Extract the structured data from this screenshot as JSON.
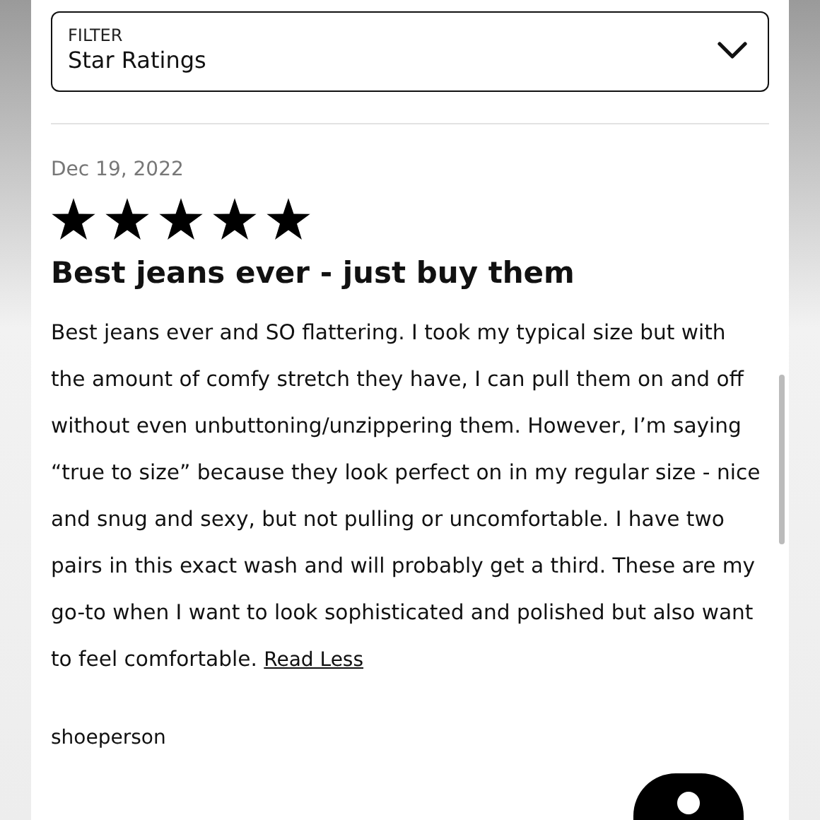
{
  "filter": {
    "label": "FILTER",
    "value": "Star Ratings"
  },
  "review": {
    "date": "Dec 19, 2022",
    "stars": 5,
    "title": "Best jeans ever - just buy them",
    "body": "Best jeans ever and SO flattering. I took my typical size but with the amount of comfy stretch they have, I can pull them on and off without even unbuttoning/unzippering them. However, I’m saying “true to size” because they look perfect on in my regular size - nice and snug and sexy, but not pulling or uncomfortable. I have two pairs in this exact wash and will probably get a third. These are my go-to when I want to look sophisticated and polished but also want to feel comfortable.",
    "link": "Read Less",
    "author": "shoeperson"
  }
}
